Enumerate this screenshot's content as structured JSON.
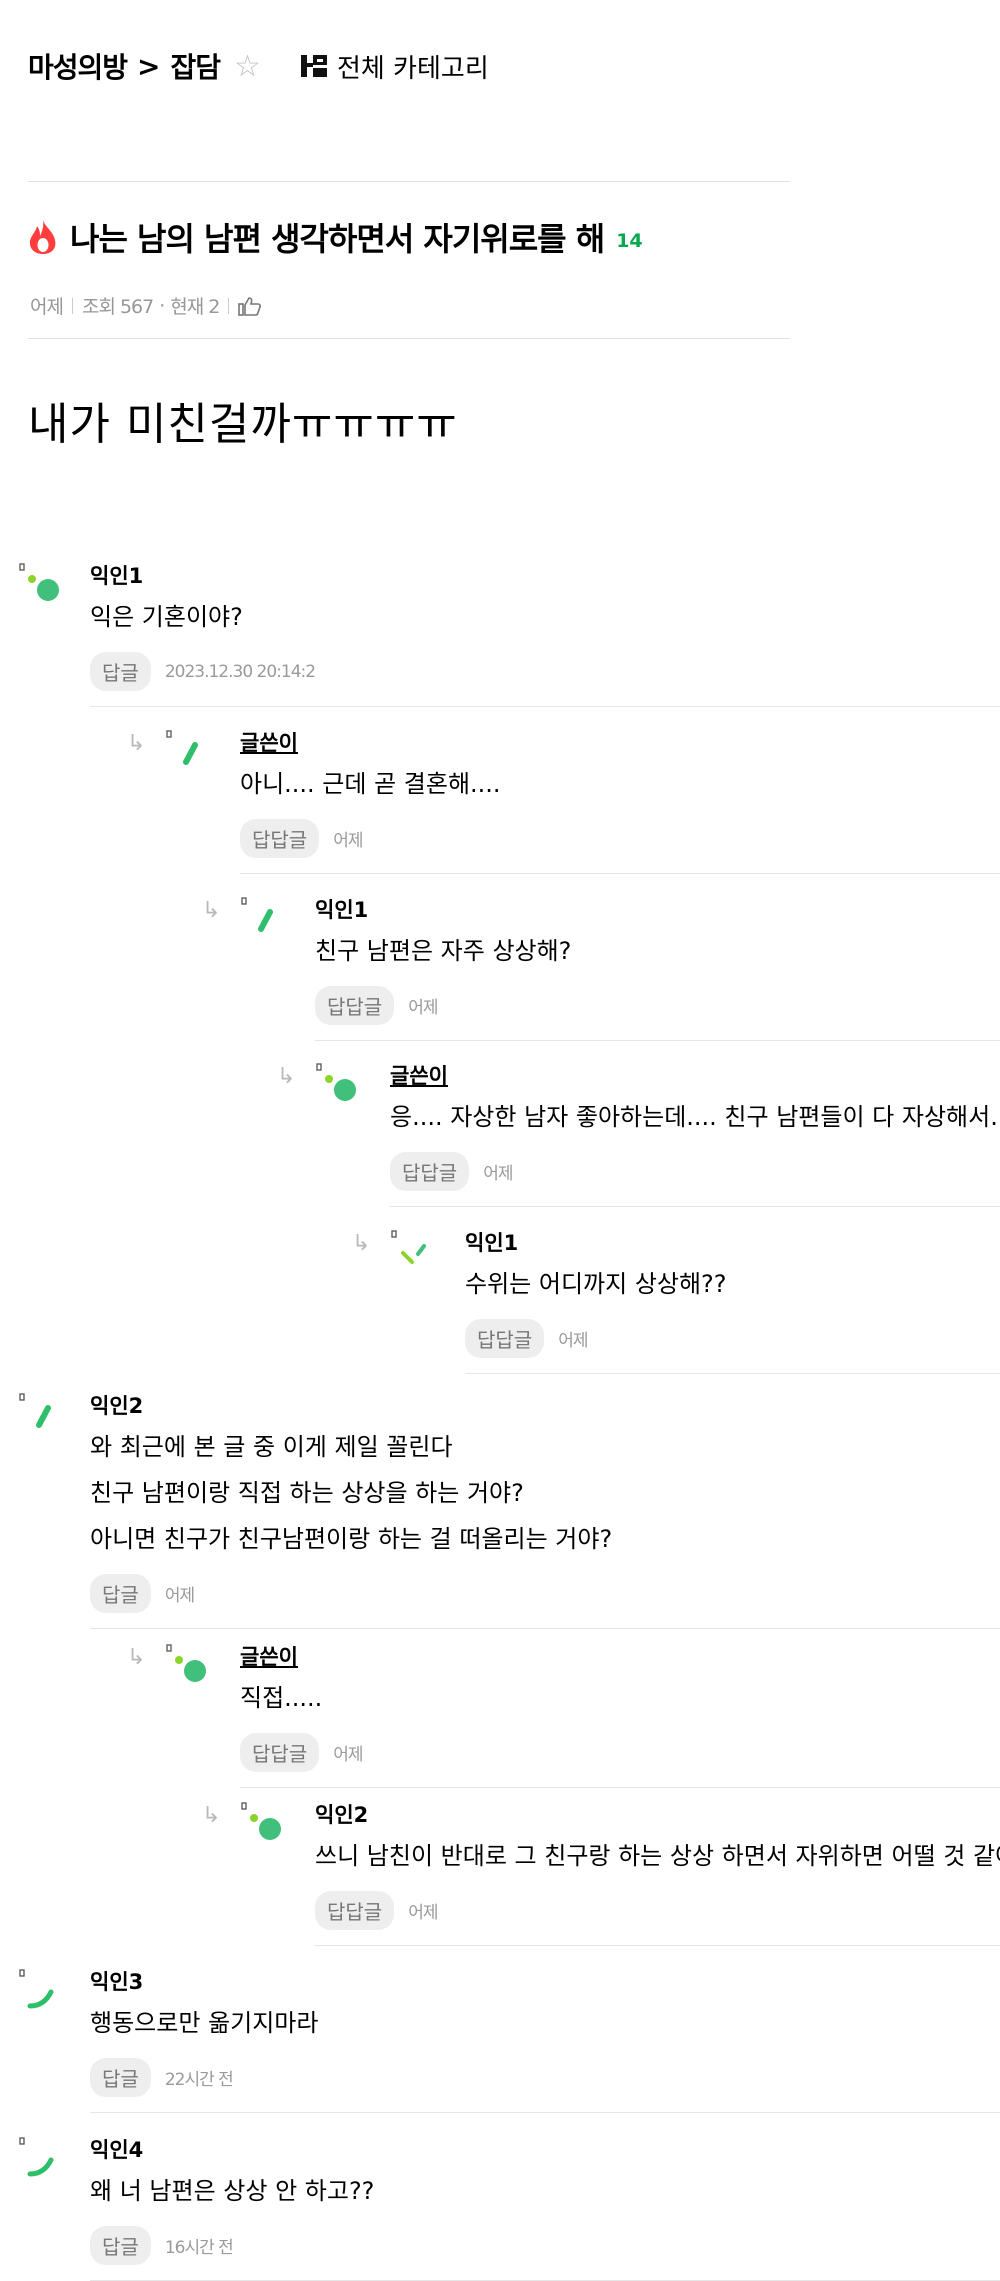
{
  "breadcrumb": {
    "board": "마성의방",
    "sep": ">",
    "category": "잡담",
    "all_categories": "전체 카테고리"
  },
  "post": {
    "title": "나는 남의 남편 생각하면서 자기위로를 해",
    "comment_count": "14",
    "date": "어제",
    "views": "조회 567",
    "dot": "·",
    "current": "현재 2",
    "body": "내가 미친걸까ㅠㅠㅠㅠ"
  },
  "comments": [
    {
      "nick": "익인1",
      "author": false,
      "lines": [
        "익은 기혼이야?"
      ],
      "reply_label": "답글",
      "date": "2023.12.30 20:14:2"
    },
    {
      "nick": "글쓴이",
      "author": true,
      "lines": [
        "아니.... 근데 곧 결혼해...."
      ],
      "reply_label": "답답글",
      "date": "어제"
    },
    {
      "nick": "익인1",
      "author": false,
      "lines": [
        "친구 남편은 자주 상상해?"
      ],
      "reply_label": "답답글",
      "date": "어제"
    },
    {
      "nick": "글쓴이",
      "author": true,
      "lines": [
        "응.... 자상한 남자 좋아하는데.... 친구 남편들이 다 자상해서....."
      ],
      "reply_label": "답답글",
      "date": "어제"
    },
    {
      "nick": "익인1",
      "author": false,
      "lines": [
        "수위는 어디까지 상상해??"
      ],
      "reply_label": "답답글",
      "date": "어제"
    },
    {
      "nick": "익인2",
      "author": false,
      "lines": [
        "와 최근에 본 글 중 이게 제일 꼴린다",
        "친구 남편이랑 직접 하는 상상을 하는 거야?",
        "아니면 친구가 친구남편이랑 하는 걸 떠올리는 거야?"
      ],
      "reply_label": "답글",
      "date": "어제"
    },
    {
      "nick": "글쓴이",
      "author": true,
      "lines": [
        "직접....."
      ],
      "reply_label": "답답글",
      "date": "어제"
    },
    {
      "nick": "익인2",
      "author": false,
      "lines": [
        "쓰니 남친이 반대로 그 친구랑 하는 상상 하면서 자위하면 어떨 것 같아?"
      ],
      "reply_label": "답답글",
      "date": "어제"
    },
    {
      "nick": "익인3",
      "author": false,
      "lines": [
        "행동으로만 옮기지마라"
      ],
      "reply_label": "답글",
      "date": "22시간 전"
    },
    {
      "nick": "익인4",
      "author": false,
      "lines": [
        "왜 너 남편은 상상 안 하고??"
      ],
      "reply_label": "답글",
      "date": "16시간 전"
    }
  ],
  "icons": {
    "hot": "fire-icon",
    "like": "thumbs-up-icon",
    "reply": "reply-arrow-icon",
    "star": "star-outline-icon",
    "category": "category-grid-icon"
  },
  "colors": {
    "accent_green": "#03a94d",
    "hot_red": "#ff3d3d",
    "avatar_green": "#41c07c",
    "avatar_lime": "#8bd42b"
  }
}
